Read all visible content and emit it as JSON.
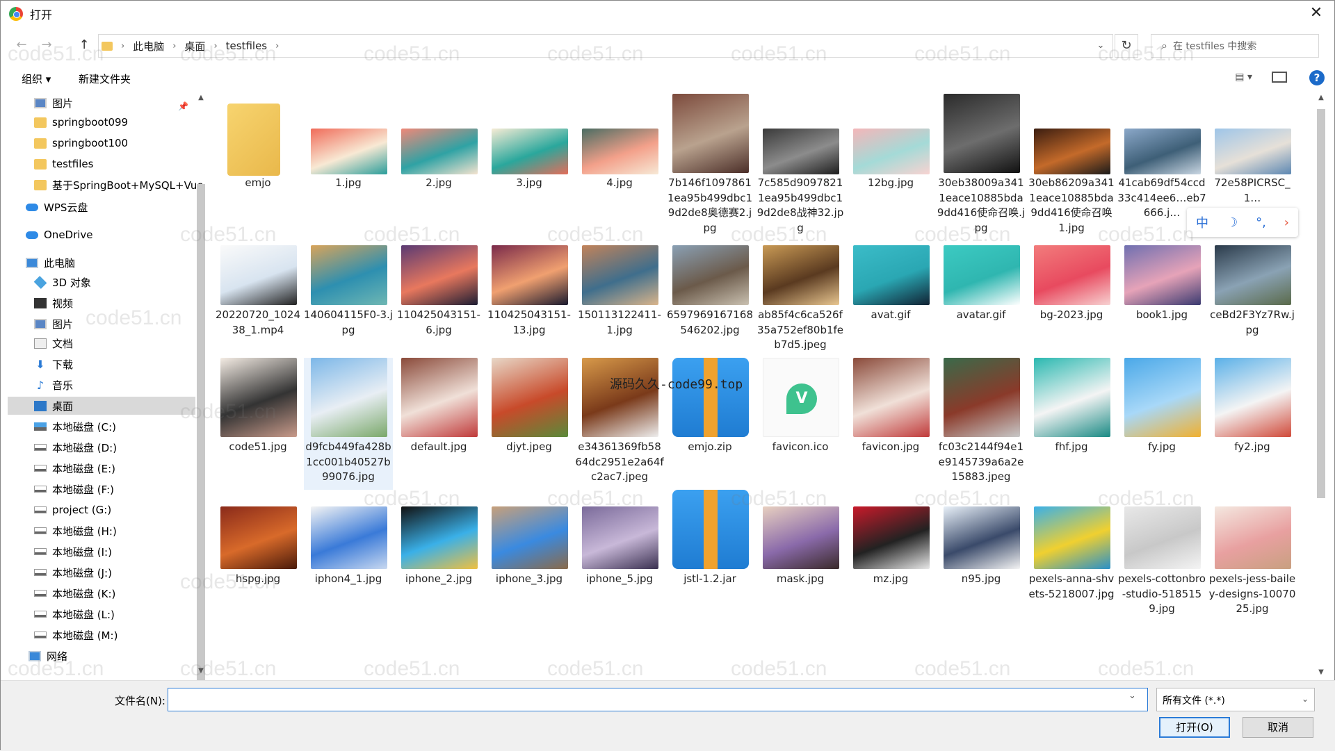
{
  "window": {
    "title": "打开"
  },
  "address": {
    "crumbs": [
      "此电脑",
      "桌面",
      "testfiles"
    ],
    "search_placeholder": "在 testfiles 中搜索"
  },
  "toolbar": {
    "organize": "组织 ▾",
    "new_folder": "新建文件夹"
  },
  "sidebar": {
    "items": [
      {
        "label": "图片",
        "icon": "pictures-icon"
      },
      {
        "label": "springboot099",
        "icon": "folder-icon"
      },
      {
        "label": "springboot100",
        "icon": "folder-icon"
      },
      {
        "label": "testfiles",
        "icon": "folder-icon"
      },
      {
        "label": "基于SpringBoot+MySQL+Vue",
        "icon": "folder-icon"
      },
      {
        "label": "WPS云盘",
        "icon": "cloud-icon"
      },
      {
        "label": "OneDrive",
        "icon": "cloud-icon"
      },
      {
        "label": "此电脑",
        "icon": "pc-icon"
      },
      {
        "label": "3D 对象",
        "icon": "3d-objects-icon"
      },
      {
        "label": "视频",
        "icon": "video-icon"
      },
      {
        "label": "图片",
        "icon": "pictures-icon"
      },
      {
        "label": "文档",
        "icon": "documents-icon"
      },
      {
        "label": "下载",
        "icon": "download-icon"
      },
      {
        "label": "音乐",
        "icon": "music-icon"
      },
      {
        "label": "桌面",
        "icon": "desktop-icon",
        "selected": true
      },
      {
        "label": "本地磁盘 (C:)",
        "icon": "drive-icon"
      },
      {
        "label": "本地磁盘 (D:)",
        "icon": "drive-icon"
      },
      {
        "label": "本地磁盘 (E:)",
        "icon": "drive-icon"
      },
      {
        "label": "本地磁盘 (F:)",
        "icon": "drive-icon"
      },
      {
        "label": "project (G:)",
        "icon": "drive-icon"
      },
      {
        "label": "本地磁盘 (H:)",
        "icon": "drive-icon"
      },
      {
        "label": "本地磁盘 (I:)",
        "icon": "drive-icon"
      },
      {
        "label": "本地磁盘 (J:)",
        "icon": "drive-icon"
      },
      {
        "label": "本地磁盘 (K:)",
        "icon": "drive-icon"
      },
      {
        "label": "本地磁盘 (L:)",
        "icon": "drive-icon"
      },
      {
        "label": "本地磁盘 (M:)",
        "icon": "drive-icon"
      },
      {
        "label": "网络",
        "icon": "network-icon"
      }
    ]
  },
  "files": [
    {
      "name": "emjo",
      "kind": "folder"
    },
    {
      "name": "1.jpg",
      "colors": [
        "#f06c5a",
        "#f8e9d4",
        "#2a9d9a"
      ]
    },
    {
      "name": "2.jpg",
      "colors": [
        "#f08878",
        "#2fa2a4",
        "#f5e3cf"
      ]
    },
    {
      "name": "3.jpg",
      "colors": [
        "#f7ecd5",
        "#2aa79c",
        "#e46d5a"
      ]
    },
    {
      "name": "4.jpg",
      "colors": [
        "#4a6c62",
        "#f3a08a",
        "#f7e9d6"
      ]
    },
    {
      "name": "7b146f10978611ea95b499dbc19d2de8奥德赛2.jpg",
      "colors": [
        "#7c4a3c",
        "#b9a28e",
        "#4b2e28"
      ],
      "tall": true
    },
    {
      "name": "7c585d90978211ea95b499dbc19d2de8战神32.jpg",
      "colors": [
        "#3a3a3a",
        "#8c8c8c",
        "#1d1d1d"
      ]
    },
    {
      "name": "12bg.jpg",
      "colors": [
        "#f4b6b9",
        "#a4dad7",
        "#f8d3d1"
      ]
    },
    {
      "name": "30eb38009a3411eace10885bda9dd416使命召唤.jpg",
      "colors": [
        "#2b2b2b",
        "#6d6d6d",
        "#111"
      ],
      "tall": true
    },
    {
      "name": "30eb86209a3411eace10885bda9dd416使命召唤1.jpg",
      "colors": [
        "#3b1d10",
        "#c46a2a",
        "#1a1a1a"
      ]
    },
    {
      "name": "41cab69df54ccd33c414ee6…eb7666.j…",
      "colors": [
        "#8ba8c9",
        "#3e5f77",
        "#c9d6e2"
      ]
    },
    {
      "name": "72e58PICRSC_1…",
      "colors": [
        "#9ec5e8",
        "#e6e0d8",
        "#5c87b2"
      ]
    },
    {
      "name": "20220720_102438_1.mp4",
      "colors": [
        "#fafafa",
        "#d8e4f0",
        "#222"
      ]
    },
    {
      "name": "140604115F0-3.jpg",
      "colors": [
        "#d9a45a",
        "#2d8fb0",
        "#6fb7b3"
      ]
    },
    {
      "name": "110425043151-6.jpg",
      "colors": [
        "#5a3a73",
        "#e8785e",
        "#1d1d33"
      ]
    },
    {
      "name": "110425043151-13.jpg",
      "colors": [
        "#7a2a4a",
        "#f0a070",
        "#1a1a2e"
      ]
    },
    {
      "name": "150113122411-1.jpg",
      "colors": [
        "#c2835a",
        "#3f6e8c",
        "#d9b48b"
      ]
    },
    {
      "name": "6597969167168546202.jpg",
      "colors": [
        "#8aa0b4",
        "#6b5a4a",
        "#c9c0b0"
      ]
    },
    {
      "name": "ab85f4c6ca526f35a752ef80b1feb7d5.jpeg",
      "colors": [
        "#c99a55",
        "#5a3a20",
        "#e8c690"
      ]
    },
    {
      "name": "avat.gif",
      "colors": [
        "#3bbcc8",
        "#2aa7b3",
        "#123"
      ]
    },
    {
      "name": "avatar.gif",
      "colors": [
        "#3ccac2",
        "#2fb6b0",
        "#fff"
      ]
    },
    {
      "name": "bg-2023.jpg",
      "colors": [
        "#f27c7c",
        "#e84a5f",
        "#f7d1d1"
      ]
    },
    {
      "name": "book1.jpg",
      "colors": [
        "#6f6fb0",
        "#e6a3b8",
        "#3a3a70"
      ]
    },
    {
      "name": "ceBd2F3Yz7Rw.jpg",
      "colors": [
        "#2a3a4a",
        "#8aa2b4",
        "#5a6a4a"
      ]
    },
    {
      "name": "code51.jpg",
      "colors": [
        "#f4ece4",
        "#333",
        "#c89a8a"
      ]
    },
    {
      "name": "d9fcb449fa428b1cc001b40527b99076.jpg",
      "colors": [
        "#7cb7e8",
        "#e8eef4",
        "#7aa86a"
      ],
      "hover": true
    },
    {
      "name": "default.jpg",
      "colors": [
        "#8a4a3a",
        "#f0e0d8",
        "#c03a3a"
      ]
    },
    {
      "name": "djyt.jpeg",
      "colors": [
        "#e8d8c8",
        "#c84a2a",
        "#5a8a3a"
      ]
    },
    {
      "name": "e34361369fb5864dc2951e2a64fc2ac7.jpeg",
      "colors": [
        "#d89a4a",
        "#7a3a1a",
        "#eee"
      ]
    },
    {
      "name": "emjo.zip",
      "kind": "zip"
    },
    {
      "name": "favicon.ico",
      "kind": "favicon"
    },
    {
      "name": "favicon.jpg",
      "colors": [
        "#8a4a3a",
        "#f0e0d8",
        "#c03a3a"
      ]
    },
    {
      "name": "fc03c2144f94e1e9145739a6a2e15883.jpeg",
      "colors": [
        "#3a6a4a",
        "#8a3a2a",
        "#c8c8c8"
      ]
    },
    {
      "name": "fhf.jpg",
      "colors": [
        "#2ab8b0",
        "#f4f4f4",
        "#1a8a84"
      ]
    },
    {
      "name": "fy.jpg",
      "colors": [
        "#4aa8e8",
        "#a8d8f8",
        "#f0b030"
      ]
    },
    {
      "name": "fy2.jpg",
      "colors": [
        "#5ab0e8",
        "#f4f4f4",
        "#d04a3a"
      ]
    },
    {
      "name": "hspg.jpg",
      "colors": [
        "#8a2a1a",
        "#d86a2a",
        "#4a1a0a"
      ]
    },
    {
      "name": "iphon4_1.jpg",
      "colors": [
        "#f4f4f4",
        "#3a7ad8",
        "#c8d8f0"
      ]
    },
    {
      "name": "iphone_2.jpg",
      "colors": [
        "#111",
        "#3ab0e8",
        "#f0c040"
      ]
    },
    {
      "name": "iphone_3.jpg",
      "colors": [
        "#c8a07a",
        "#3a8ae0",
        "#8a6a4a"
      ]
    },
    {
      "name": "iphone_5.jpg",
      "colors": [
        "#7a6a9a",
        "#c8b8d8",
        "#3a3050"
      ]
    },
    {
      "name": "jstl-1.2.jar",
      "kind": "zip"
    },
    {
      "name": "mask.jpg",
      "colors": [
        "#e8d0c0",
        "#8a6aaa",
        "#3a2a2a"
      ]
    },
    {
      "name": "mz.jpg",
      "colors": [
        "#c81a2a",
        "#222",
        "#e8e8e8"
      ]
    },
    {
      "name": "n95.jpg",
      "colors": [
        "#e8f0f8",
        "#3a4a6a",
        "#f4f4f4"
      ]
    },
    {
      "name": "pexels-anna-shvets-5218007.jpg",
      "colors": [
        "#3ab0e8",
        "#f0d030",
        "#2a90c8"
      ]
    },
    {
      "name": "pexels-cottonbro-studio-5185159.jpg",
      "colors": [
        "#e8e8e8",
        "#c8c8c8",
        "#f4f4f4"
      ]
    },
    {
      "name": "pexels-jess-bailey-designs-1007025.jpg",
      "colors": [
        "#f4e8e0",
        "#e8a0a0",
        "#c8a080"
      ]
    }
  ],
  "ime": {
    "lang": "中",
    "moon": "☽",
    "dots": "°,",
    "arrow": "›"
  },
  "overlay_text": "源码久久-code99.top",
  "watermark": "code51.cn",
  "bottom": {
    "filename_label": "文件名(N):",
    "filename_value": "",
    "filter": "所有文件 (*.*)",
    "open": "打开(O)",
    "cancel": "取消"
  }
}
